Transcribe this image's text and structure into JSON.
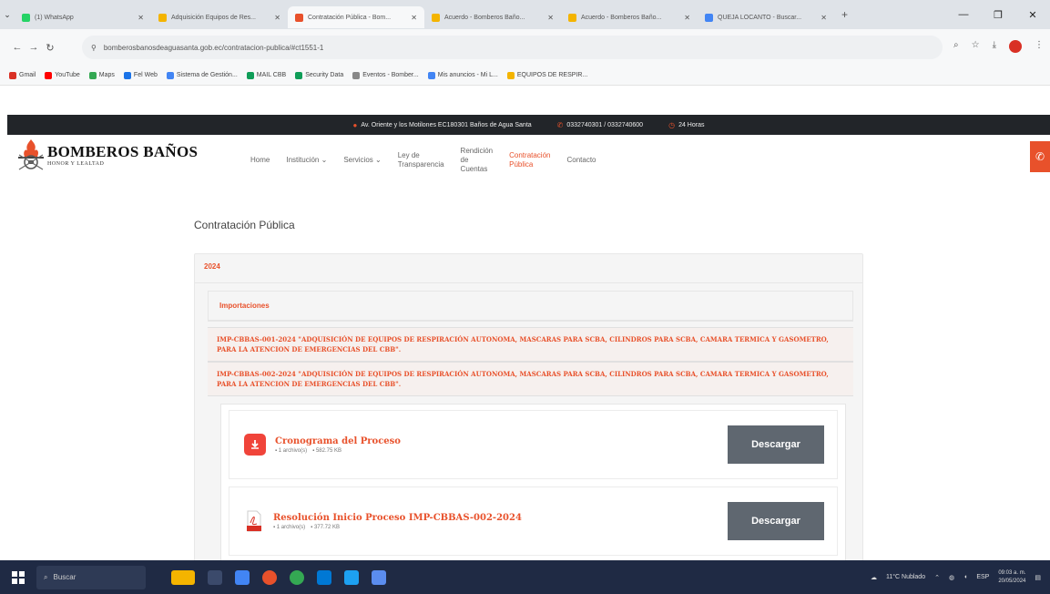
{
  "browser": {
    "tabs": [
      {
        "label": "(1) WhatsApp",
        "color": "#25d366",
        "active": false
      },
      {
        "label": "Adquisición Equipos de Res...",
        "color": "#f4b400",
        "active": false
      },
      {
        "label": "Contratación Pública - Bom...",
        "color": "#e8512b",
        "active": true
      },
      {
        "label": "Acuerdo - Bomberos Baño...",
        "color": "#f4b400",
        "active": false
      },
      {
        "label": "Acuerdo - Bomberos Baño...",
        "color": "#f4b400",
        "active": false
      },
      {
        "label": "QUEJA LOCANTO - Buscar...",
        "color": "#4285f4",
        "active": false
      }
    ],
    "url": "bomberosbanosdeaguasanta.gob.ec/contratacion-publica/#ct1551-1",
    "bookmarks": [
      {
        "label": "Gmail",
        "color": "#d93025"
      },
      {
        "label": "YouTube",
        "color": "#ff0000"
      },
      {
        "label": "Maps",
        "color": "#34a853"
      },
      {
        "label": "Fel Web",
        "color": "#1a73e8"
      },
      {
        "label": "Sistema de Gestión...",
        "color": "#4285f4"
      },
      {
        "label": "MAIL CBB",
        "color": "#0f9d58"
      },
      {
        "label": "Security Data",
        "color": "#0f9d58"
      },
      {
        "label": "Eventos - Bomber...",
        "color": "#888888"
      },
      {
        "label": "Mis anuncios - Mi L...",
        "color": "#4285f4"
      },
      {
        "label": "EQUIPOS DE RESPIR...",
        "color": "#f4b400"
      }
    ]
  },
  "site": {
    "topbar": {
      "address": "Av. Oriente y los Motilones EC180301 Baños de Agua Santa",
      "phone": "0332740301 / 0332740600",
      "hours": "24 Horas"
    },
    "logo": {
      "name": "BOMBEROS BAÑOS",
      "motto": "HONOR Y LEALTAD"
    },
    "menu": [
      {
        "label": "Home",
        "sub": "",
        "active": false
      },
      {
        "label": "Institución",
        "sub": "⌄",
        "active": false
      },
      {
        "label": "Servicios",
        "sub": "⌄",
        "active": false
      },
      {
        "label": "Ley de\nTransparencia",
        "sub": "",
        "active": false
      },
      {
        "label": "Rendición\nde\nCuentas",
        "sub": "",
        "active": false
      },
      {
        "label": "Contratación\nPública",
        "sub": "",
        "active": true
      },
      {
        "label": "Contacto",
        "sub": "",
        "active": false
      }
    ],
    "page_title": "Contratación Pública",
    "year": "2024",
    "category": "Importaciones",
    "processes": [
      "IMP-CBBAS-001-2024 \"ADQUISICIÓN DE EQUIPOS DE RESPIRACIÓN AUTONOMA, MASCARAS PARA SCBA, CILINDROS PARA SCBA, CAMARA TERMICA Y GASOMETRO, PARA LA ATENCION DE EMERGENCIAS DEL CBB\".",
      "IMP-CBBAS-002-2024 \"ADQUISICIÓN DE EQUIPOS DE RESPIRACIÓN AUTONOMA, MASCARAS PARA SCBA, CILINDROS PARA SCBA, CAMARA TERMICA Y GASOMETRO, PARA LA ATENCION DE EMERGENCIAS DEL CBB\"."
    ],
    "files": [
      {
        "title": "Cronograma del Proceso",
        "count": "1 archivo(s)",
        "size": "582.75 KB",
        "button": "Descargar"
      },
      {
        "title": "Resolución Inicio Proceso IMP-CBBAS-002-2024",
        "count": "1 archivo(s)",
        "size": "377.72 KB",
        "button": "Descargar"
      }
    ]
  },
  "taskbar": {
    "search": "Buscar",
    "weather": "11°C Nublado",
    "lang": "ESP",
    "time": "09:03 a. m.",
    "date": "20/05/2024"
  },
  "colors": {
    "accent": "#e8512b",
    "button": "#5f6770",
    "topbar": "#222529"
  }
}
